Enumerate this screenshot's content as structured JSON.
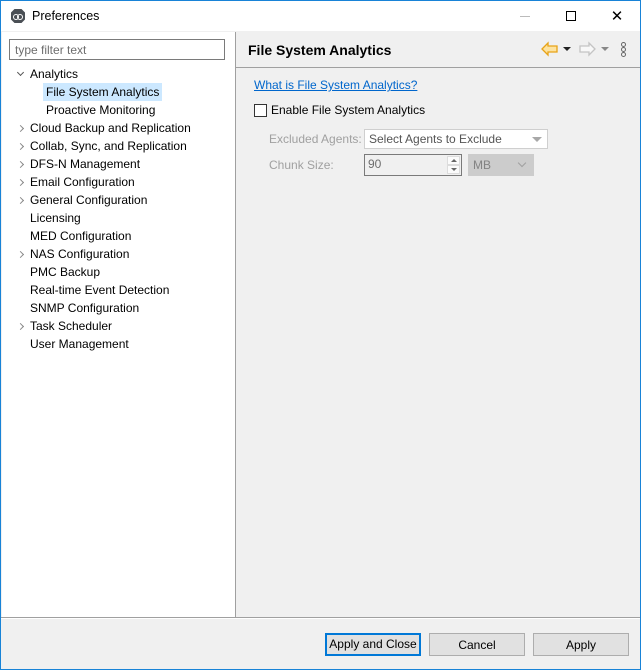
{
  "window": {
    "title": "Preferences",
    "icon": "app-logo-icon",
    "controls": {
      "minimize": "minimize-icon",
      "maximize": "maximize-icon",
      "close": "close-icon",
      "close_glyph": "✕"
    }
  },
  "sidebar": {
    "filter": {
      "value": "",
      "placeholder": "type filter text"
    },
    "tree": [
      {
        "label": "Analytics",
        "level": 0,
        "expandable": true,
        "expanded": true
      },
      {
        "label": "File System Analytics",
        "level": 1,
        "selected": true
      },
      {
        "label": "Proactive Monitoring",
        "level": 1
      },
      {
        "label": "Cloud Backup and Replication",
        "level": 0,
        "expandable": true
      },
      {
        "label": "Collab, Sync, and Replication",
        "level": 0,
        "expandable": true
      },
      {
        "label": "DFS-N Management",
        "level": 0,
        "expandable": true
      },
      {
        "label": "Email Configuration",
        "level": 0,
        "expandable": true
      },
      {
        "label": "General Configuration",
        "level": 0,
        "expandable": true
      },
      {
        "label": "Licensing",
        "level": 0
      },
      {
        "label": "MED Configuration",
        "level": 0
      },
      {
        "label": "NAS Configuration",
        "level": 0,
        "expandable": true
      },
      {
        "label": "PMC Backup",
        "level": 0
      },
      {
        "label": "Real-time Event Detection",
        "level": 0
      },
      {
        "label": "SNMP Configuration",
        "level": 0
      },
      {
        "label": "Task Scheduler",
        "level": 0,
        "expandable": true
      },
      {
        "label": "User Management",
        "level": 0
      }
    ]
  },
  "page": {
    "title": "File System Analytics",
    "nav": {
      "back": "back-arrow-icon",
      "forward": "forward-arrow-icon",
      "menu": "view-menu-icon",
      "back_color": "#e8a317"
    },
    "help_link": "What is File System Analytics?",
    "enable_checkbox": {
      "label": "Enable File System Analytics",
      "checked": false
    },
    "excluded_agents": {
      "label": "Excluded Agents:",
      "value": "Select Agents to Exclude",
      "enabled": false
    },
    "chunk_size": {
      "label": "Chunk Size:",
      "value": "90",
      "unit": "MB",
      "enabled": false
    }
  },
  "buttons": {
    "apply_and_close": "Apply and Close",
    "cancel": "Cancel",
    "apply": "Apply"
  },
  "colors": {
    "accent": "#0078d7",
    "link": "#0066cc",
    "selection": "#cce8ff",
    "window_border": "#1883d7"
  }
}
